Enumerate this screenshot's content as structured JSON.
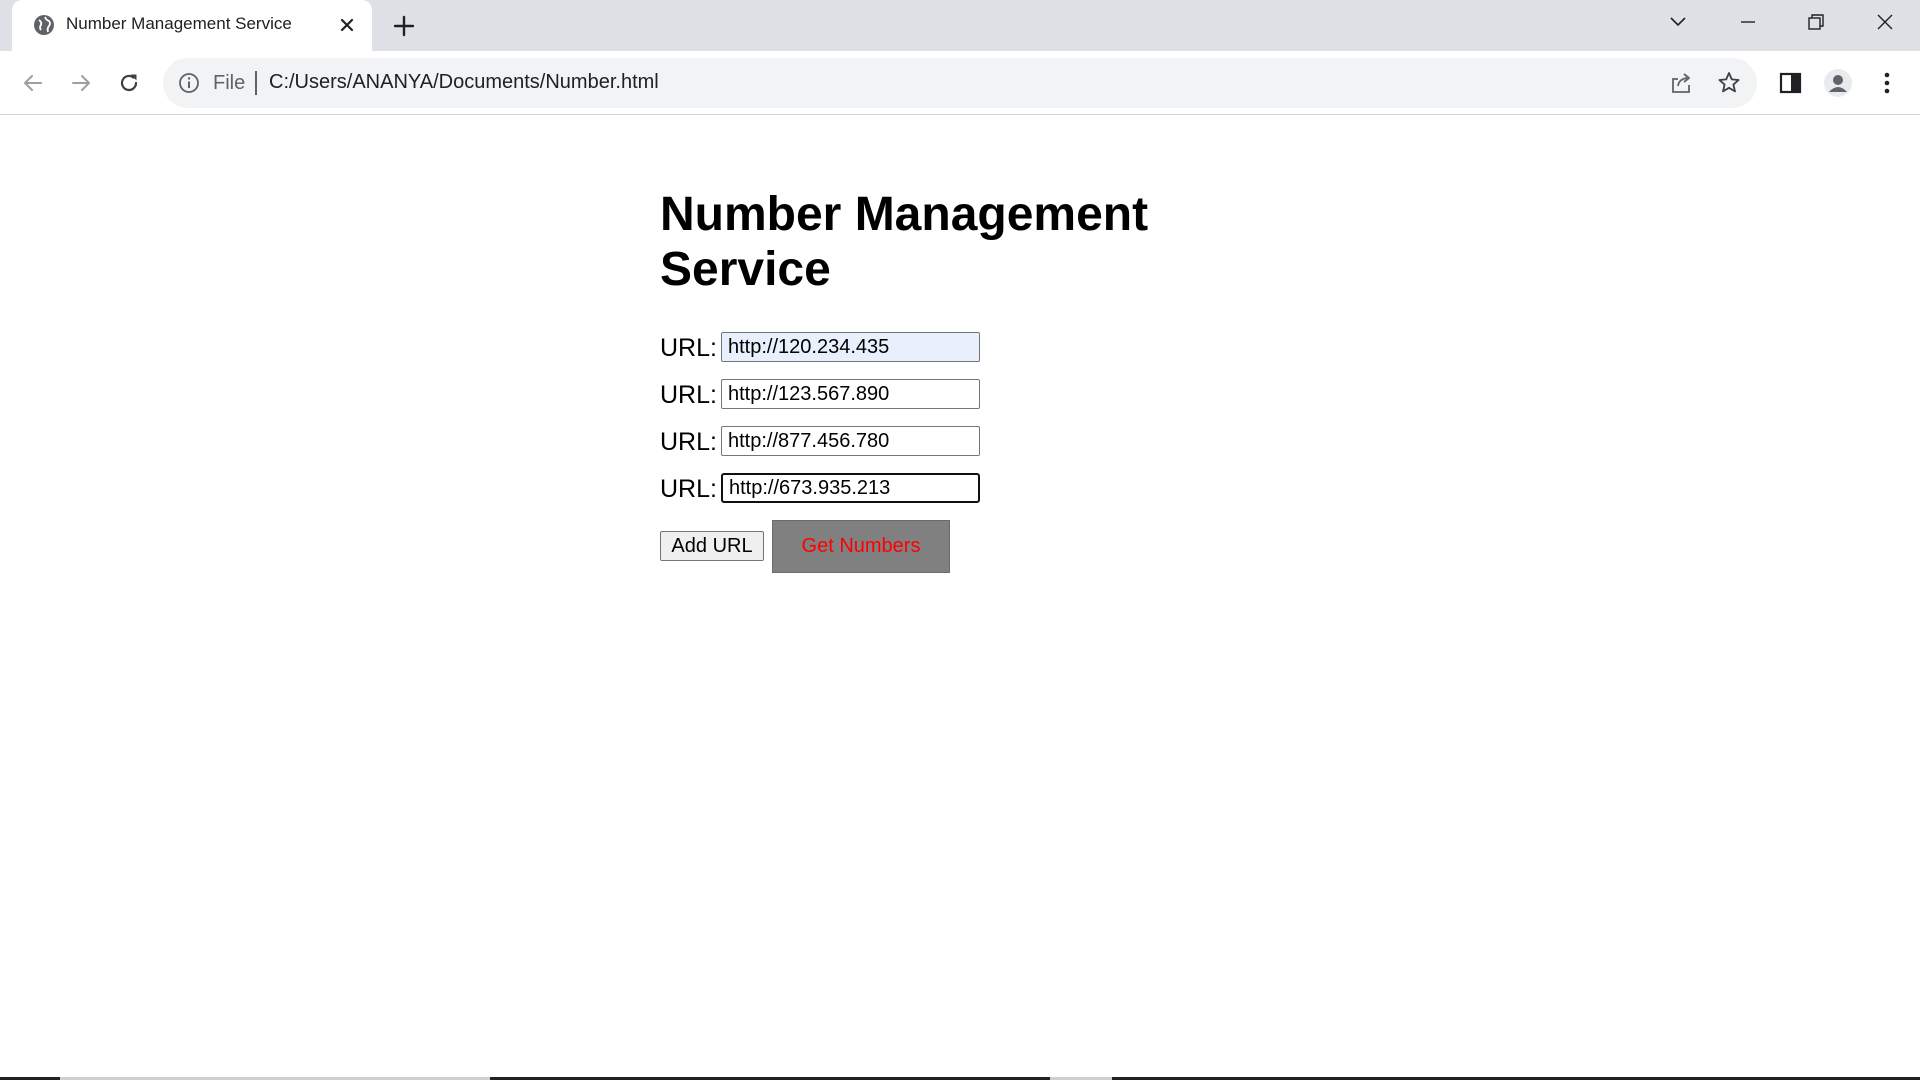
{
  "browser": {
    "tab": {
      "title": "Number Management Service"
    },
    "address_bar": {
      "scheme_label": "File",
      "url": "C:/Users/ANANYA/Documents/Number.html"
    }
  },
  "page": {
    "heading": "Number Management Service",
    "url_fields": [
      {
        "label": "URL:",
        "value": "http://120.234.435",
        "autofilled": true,
        "focused": false
      },
      {
        "label": "URL:",
        "value": "http://123.567.890",
        "autofilled": false,
        "focused": false
      },
      {
        "label": "URL:",
        "value": "http://877.456.780",
        "autofilled": false,
        "focused": false
      },
      {
        "label": "URL:",
        "value": "http://673.935.213",
        "autofilled": false,
        "focused": true
      }
    ],
    "buttons": {
      "add_url": "Add URL",
      "get_numbers": "Get Numbers"
    }
  },
  "colors": {
    "get_numbers_bg": "#808080",
    "get_numbers_text": "#ff0000",
    "autofill_bg": "#e8f0fe",
    "chrome_frame": "#dee1e6"
  },
  "icons": {
    "tab_favicon": "globe-icon",
    "tab_close": "close-icon",
    "new_tab": "plus-icon",
    "back": "arrow-left-icon",
    "forward": "arrow-right-icon",
    "reload": "reload-icon",
    "site_info": "info-icon",
    "share": "share-icon",
    "bookmark": "star-icon",
    "side_panel": "side-panel-icon",
    "profile": "profile-icon",
    "menu": "kebab-menu-icon"
  }
}
